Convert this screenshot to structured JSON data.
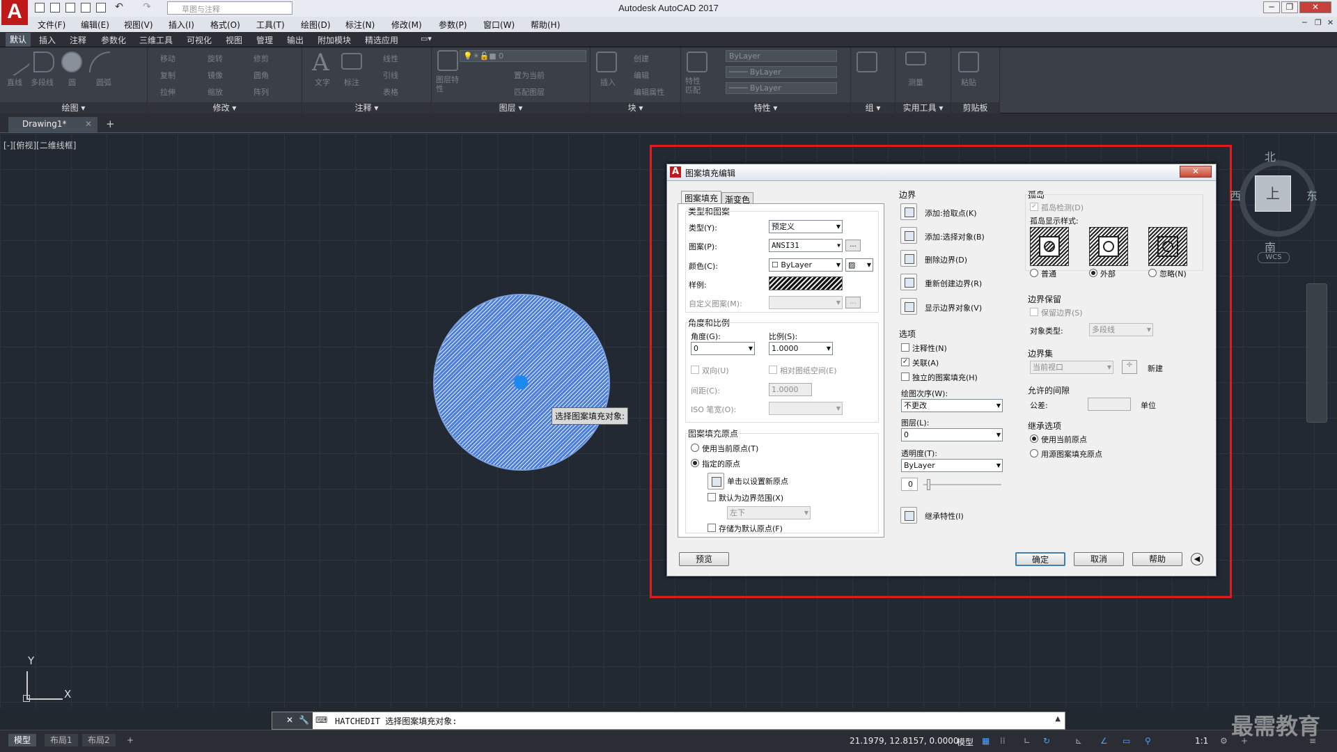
{
  "app": {
    "title": "Autodesk AutoCAD 2017",
    "logo": "A",
    "workspace": "草图与注释"
  },
  "menu": [
    "文件(F)",
    "编辑(E)",
    "视图(V)",
    "插入(I)",
    "格式(O)",
    "工具(T)",
    "绘图(D)",
    "标注(N)",
    "修改(M)",
    "参数(P)",
    "窗口(W)",
    "帮助(H)"
  ],
  "ribbon_tabs": [
    "默认",
    "插入",
    "注释",
    "参数化",
    "三维工具",
    "可视化",
    "视图",
    "管理",
    "输出",
    "附加模块",
    "精选应用"
  ],
  "ribbon_panels": [
    "绘图",
    "修改",
    "注释",
    "图层",
    "块",
    "特性",
    "组",
    "实用工具",
    "剪贴板"
  ],
  "ribbon_items": {
    "draw": [
      "直线",
      "多段线",
      "圆",
      "圆弧"
    ],
    "modify": [
      "移动",
      "旋转",
      "修剪",
      "复制",
      "镜像",
      "圆角",
      "拉伸",
      "缩放",
      "阵列"
    ],
    "annot": [
      "文字",
      "标注",
      "线性",
      "引线",
      "表格"
    ],
    "layer": [
      "图层特性",
      "置为当前",
      "匹配图层"
    ],
    "layer_combo": "0",
    "block": [
      "插入",
      "创建",
      "编辑",
      "编辑属性"
    ],
    "props": [
      "特性匹配",
      "ByLayer",
      "ByLayer",
      "ByLayer"
    ],
    "util": [
      "测量"
    ],
    "clip": [
      "粘贴"
    ]
  },
  "doc_tab": "Drawing1*",
  "viewport_label": "[-][俯视][二维线框]",
  "tooltip": "选择图案填充对象:",
  "viewcube": {
    "n": "北",
    "s": "南",
    "e": "东",
    "w": "西",
    "top": "上",
    "wcs": "WCS"
  },
  "axis": {
    "x": "X",
    "y": "Y"
  },
  "command": "HATCHEDIT 选择图案填充对象:",
  "layout_tabs": [
    "模型",
    "布局1",
    "布局2"
  ],
  "coords": "21.1979, 12.8157, 0.0000",
  "status_model": "模型",
  "status_scale": "1:1",
  "watermark": "最需教育",
  "dialog": {
    "title": "图案填充编辑",
    "close": "✕",
    "tabs": [
      "图案填充",
      "渐变色"
    ],
    "type_pattern": {
      "group": "类型和图案",
      "type_label": "类型(Y):",
      "type_value": "预定义",
      "pattern_label": "图案(P):",
      "pattern_value": "ANSI31",
      "color_label": "颜色(C):",
      "color_value": "ByLayer",
      "swatch_label": "样例:",
      "custom_label": "自定义图案(M):",
      "dots": "..."
    },
    "angle_scale": {
      "group": "角度和比例",
      "angle_label": "角度(G):",
      "angle_value": "0",
      "scale_label": "比例(S):",
      "scale_value": "1.0000",
      "double": "双向(U)",
      "relative": "相对图纸空间(E)",
      "spacing_label": "间距(C):",
      "spacing_value": "1.0000",
      "iso_label": "ISO 笔宽(O):"
    },
    "origin": {
      "group": "图案填充原点",
      "use_current": "使用当前原点(T)",
      "specified": "指定的原点",
      "click_set": "单击以设置新原点",
      "default_boundary": "默认为边界范围(X)",
      "corner": "左下",
      "store": "存储为默认原点(F)"
    },
    "boundary": {
      "group": "边界",
      "add_pick": "添加:拾取点(K)",
      "add_select": "添加:选择对象(B)",
      "remove": "删除边界(D)",
      "recreate": "重新创建边界(R)",
      "show": "显示边界对象(V)"
    },
    "options": {
      "group": "选项",
      "annotative": "注释性(N)",
      "associative": "关联(A)",
      "separate": "独立的图案填充(H)",
      "draw_order_label": "绘图次序(W):",
      "draw_order_value": "不更改",
      "layer_label": "图层(L):",
      "layer_value": "0",
      "transparency_label": "透明度(T):",
      "transparency_value": "ByLayer",
      "transparency_num": "0",
      "inherit": "继承特性(I)"
    },
    "islands": {
      "group": "孤岛",
      "detect": "孤岛检测(D)",
      "style_label": "孤岛显示样式:",
      "normal": "普通",
      "outer": "外部",
      "ignore": "忽略(N)"
    },
    "retain": {
      "group": "边界保留",
      "retain": "保留边界(S)",
      "type_label": "对象类型:",
      "type_value": "多段线"
    },
    "set": {
      "group": "边界集",
      "value": "当前视口",
      "new": "新建"
    },
    "gap": {
      "group": "允许的间隙",
      "tol_label": "公差:",
      "unit": "单位"
    },
    "inherit_opts": {
      "group": "继承选项",
      "use_current": "使用当前原点",
      "use_source": "用源图案填充原点"
    },
    "buttons": {
      "preview": "预览",
      "ok": "确定",
      "cancel": "取消",
      "help": "帮助"
    }
  }
}
